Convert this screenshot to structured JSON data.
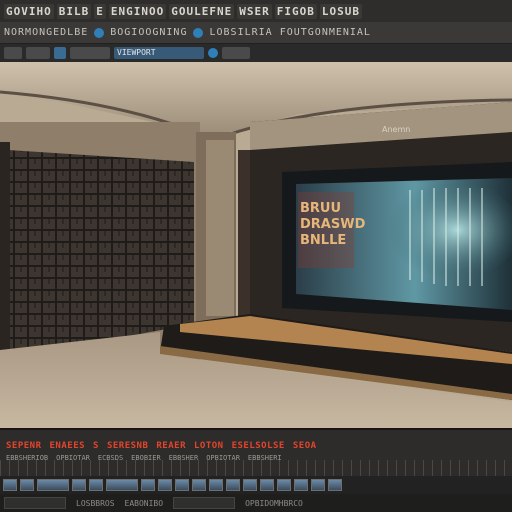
{
  "menubar": {
    "items": [
      "GOVIHO",
      "BILB",
      "E",
      "ENGINOO",
      "GOULEFNE",
      "WSER",
      "FIGOB",
      "LOSUB"
    ]
  },
  "toolbar": {
    "label_left": "NORMONGEDLBE",
    "label_mid": "BOGIOOGNING",
    "label_right": "LOBSILRIA FOUTGONMENIAL"
  },
  "toolbar2": {
    "tab_label": "VIEWPORT"
  },
  "screen": {
    "title_line1": "BRUU",
    "title_line2": "DRASWD",
    "title_line3": "BNLLE",
    "top_label": "Anemn"
  },
  "timeline": {
    "red_labels": [
      "SEPENR",
      "ENAEES",
      "S",
      "SERESNB",
      "REAER",
      "LOTON",
      "ESELSOLSE",
      "SEOA"
    ],
    "grey_labels": [
      "EBBSHERIOB",
      "OPBIOTAR",
      "ECBSDS",
      "EBOBIER",
      "EBBSHER",
      "OPBIOTAR",
      "EBBSHERI"
    ]
  },
  "status": {
    "left": "LOSBBROS",
    "center": "EABONIBO",
    "right": "OPBIDOMHBRCO"
  },
  "colors": {
    "accent_red": "#e2452d",
    "accent_blue": "#2f7fb8"
  }
}
